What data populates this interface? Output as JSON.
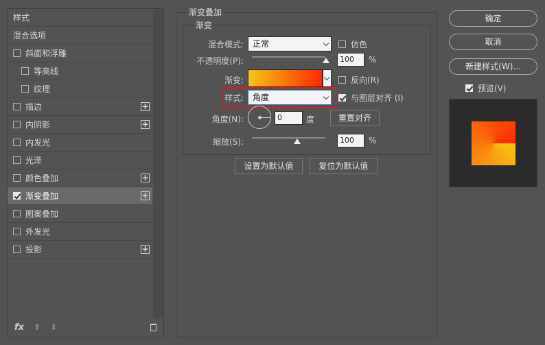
{
  "left_panel": {
    "items": [
      {
        "label": "样式",
        "checkbox": false,
        "checked": false,
        "plus": false
      },
      {
        "label": "混合选项",
        "checkbox": false,
        "checked": false,
        "plus": false
      },
      {
        "label": "斜面和浮雕",
        "checkbox": true,
        "checked": false,
        "plus": false
      },
      {
        "label": "等高线",
        "checkbox": true,
        "checked": false,
        "plus": false
      },
      {
        "label": "纹理",
        "checkbox": true,
        "checked": false,
        "plus": false
      },
      {
        "label": "描边",
        "checkbox": true,
        "checked": false,
        "plus": true
      },
      {
        "label": "内阴影",
        "checkbox": true,
        "checked": false,
        "plus": true
      },
      {
        "label": "内发光",
        "checkbox": true,
        "checked": false,
        "plus": false
      },
      {
        "label": "光泽",
        "checkbox": true,
        "checked": false,
        "plus": false
      },
      {
        "label": "颜色叠加",
        "checkbox": true,
        "checked": false,
        "plus": true
      },
      {
        "label": "渐变叠加",
        "checkbox": true,
        "checked": true,
        "plus": true
      },
      {
        "label": "图案叠加",
        "checkbox": true,
        "checked": false,
        "plus": false
      },
      {
        "label": "外发光",
        "checkbox": true,
        "checked": false,
        "plus": false
      },
      {
        "label": "投影",
        "checkbox": true,
        "checked": false,
        "plus": true
      }
    ],
    "fx_label": "fx"
  },
  "center": {
    "group_title": "渐变叠加",
    "sub_group_title": "渐变",
    "blend_mode_label": "混合模式:",
    "blend_mode_value": "正常",
    "dither_label": "仿色",
    "opacity_label": "不透明度(P):",
    "opacity_value": "100",
    "percent": "%",
    "gradient_label": "渐变:",
    "reverse_label": "反向(R)",
    "style_label": "样式:",
    "style_value": "角度",
    "align_label": "与图层对齐 (I)",
    "angle_label": "角度(N):",
    "angle_value": "0",
    "degree": "度",
    "reset_align_label": "重置对齐",
    "scale_label": "缩放(S):",
    "scale_value": "100",
    "set_default_label": "设置为默认值",
    "reset_default_label": "复位为默认值"
  },
  "right": {
    "ok_label": "确定",
    "cancel_label": "取消",
    "new_style_label": "新建样式(W)...",
    "preview_label": "预览(V)"
  },
  "colors": {
    "gradient_start": "#f5c518",
    "gradient_end": "#ff2a00",
    "highlight": "#e01b1b",
    "focus": "#3d7bd6"
  }
}
